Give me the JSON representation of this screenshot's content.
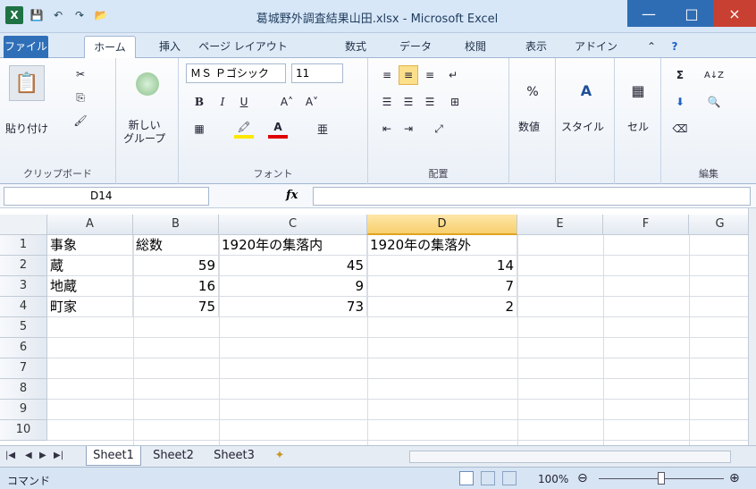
{
  "window": {
    "title": "葛城野外調査結果山田.xlsx - Microsoft Excel",
    "minimize": "—",
    "maximize": "□",
    "close": "×"
  },
  "quick_access": {
    "logo": "X",
    "save": "💾",
    "undo": "↶",
    "redo": "↷",
    "open": "📂"
  },
  "ribbon_tabs": [
    "ファイル",
    "ホーム",
    "挿入",
    "ページ レイアウト",
    "数式",
    "データ",
    "校閲",
    "表示",
    "アドイン"
  ],
  "ribbon": {
    "clipboard": {
      "paste": "貼り付け",
      "cut": "✂",
      "copy": "⎘",
      "format_painter": "🖌",
      "label": "クリップボード"
    },
    "new_group": {
      "label": "新しい\nグループ"
    },
    "font": {
      "name": "ＭＳ Ｐゴシック",
      "size": "11",
      "bold": "B",
      "italic": "I",
      "underline": "U",
      "grow": "A˄",
      "shrink": "A˅",
      "border": "▦",
      "fill": "🖍",
      "color": "A",
      "phonetic": "亜",
      "label": "フォント"
    },
    "alignment": {
      "label": "配置"
    },
    "number": {
      "percent": "%",
      "label": "数値"
    },
    "styles": {
      "label": "スタイル"
    },
    "cells": {
      "label": "セル"
    },
    "editing": {
      "sum": "Σ",
      "sort": "A↓Z",
      "find": "🔍",
      "label": "編集"
    }
  },
  "formula_bar": {
    "name_box": "D14",
    "fx": "fx",
    "value": ""
  },
  "columns": [
    "A",
    "B",
    "C",
    "D",
    "E",
    "F",
    "G"
  ],
  "selected_column": "D",
  "rows": [
    "1",
    "2",
    "3",
    "4",
    "5",
    "6",
    "7",
    "8",
    "9",
    "10"
  ],
  "table": {
    "header": [
      "事象",
      "総数",
      "1920年の集落内",
      "1920年の集落外"
    ],
    "data": [
      [
        "蔵",
        "59",
        "45",
        "14"
      ],
      [
        "地蔵",
        "16",
        "9",
        "7"
      ],
      [
        "町家",
        "75",
        "73",
        "2"
      ]
    ]
  },
  "sheets": [
    "Sheet1",
    "Sheet2",
    "Sheet3"
  ],
  "active_sheet": "Sheet1",
  "status": {
    "mode": "コマンド",
    "zoom": "100%"
  }
}
